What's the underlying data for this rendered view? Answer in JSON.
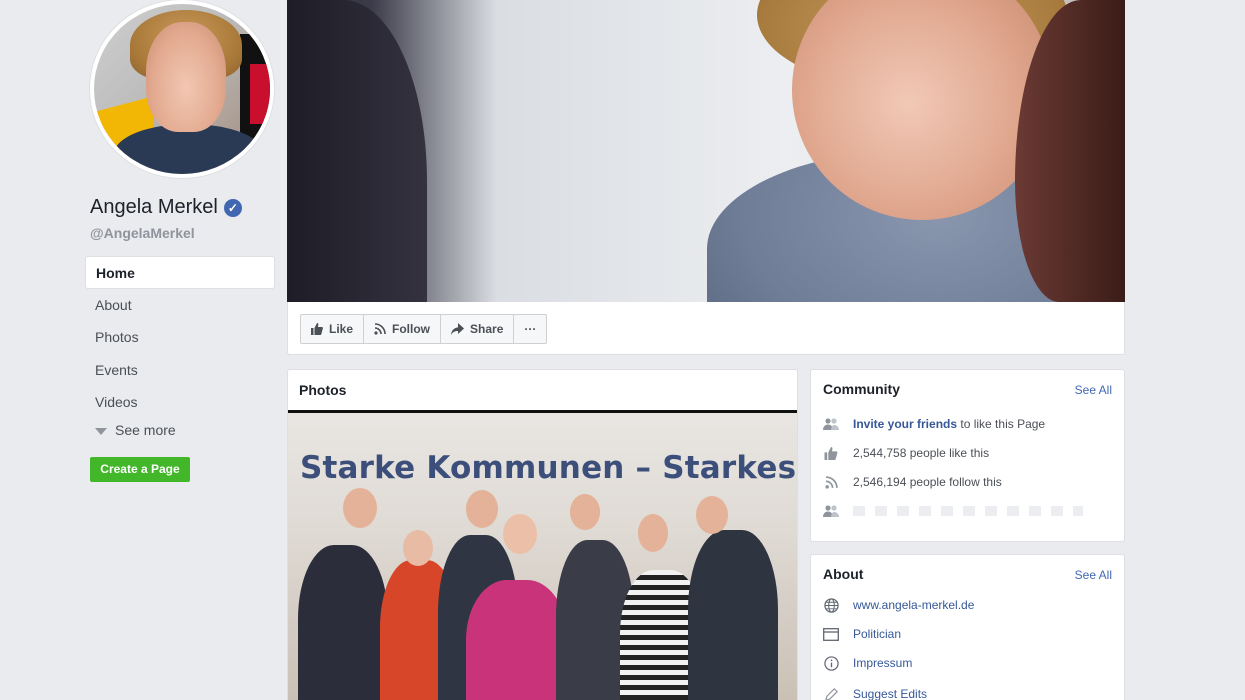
{
  "profile": {
    "name": "Angela Merkel",
    "handle": "@AngelaMerkel"
  },
  "nav": {
    "items": [
      {
        "label": "Home",
        "active": true
      },
      {
        "label": "About"
      },
      {
        "label": "Photos"
      },
      {
        "label": "Events"
      },
      {
        "label": "Videos"
      }
    ],
    "see_more": "See more",
    "create_page": "Create a Page"
  },
  "actions": {
    "like": "Like",
    "follow": "Follow",
    "share": "Share",
    "more": "···"
  },
  "photos": {
    "title": "Photos",
    "banner_text": "Starke Kommunen – Starkes De"
  },
  "community": {
    "title": "Community",
    "see_all": "See All",
    "invite_link": "Invite your friends",
    "invite_rest": "to like this Page",
    "likes": "2,544,758 people like this",
    "follows": "2,546,194 people follow this"
  },
  "about": {
    "title": "About",
    "see_all": "See All",
    "website": "www.angela-merkel.de",
    "category": "Politician",
    "impressum": "Impressum",
    "suggest_edits": "Suggest Edits"
  },
  "colors": {
    "background": "#e9ebee",
    "link": "#4267b2",
    "create_button": "#42b72a"
  }
}
